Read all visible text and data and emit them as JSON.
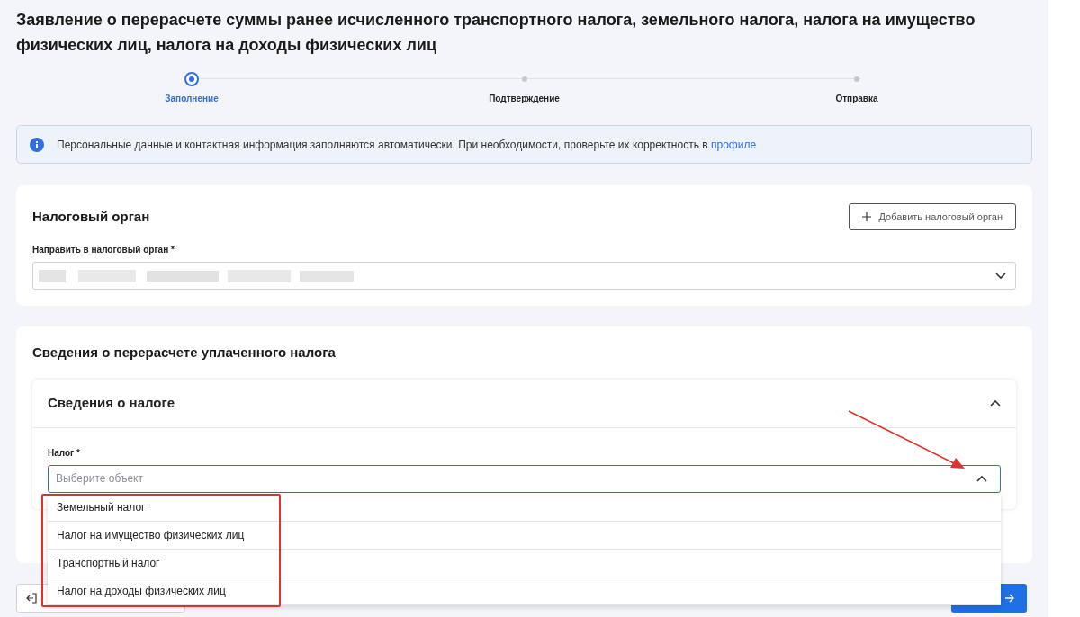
{
  "title": "Заявление о перерасчете суммы ранее исчисленного транспортного налога, земельного налога, налога на имущество физических лиц, налога на доходы физических лиц",
  "steps": [
    {
      "label": "Заполнение",
      "selected": true
    },
    {
      "label": "Подтверждение",
      "selected": false
    },
    {
      "label": "Отправка",
      "selected": false
    }
  ],
  "info": {
    "text": "Персональные данные и контактная информация заполняются автоматически. При необходимости, проверьте их корректность в",
    "link": "профиле"
  },
  "tax_authority": {
    "heading": "Налоговый орган",
    "add_button": "Добавить налоговый орган",
    "field_label": "Направить в налоговый орган *"
  },
  "recalculation": {
    "heading": "Сведения о перерасчете уплаченного налога",
    "section": {
      "title": "Сведения о налоге",
      "expanded": true,
      "field_label": "Налог *",
      "placeholder": "Выберите объект",
      "open": true,
      "options": [
        "Земельный налог",
        "Налог на имущество физических лиц",
        "Транспортный налог",
        "Налог на доходы физических лиц"
      ]
    }
  }
}
